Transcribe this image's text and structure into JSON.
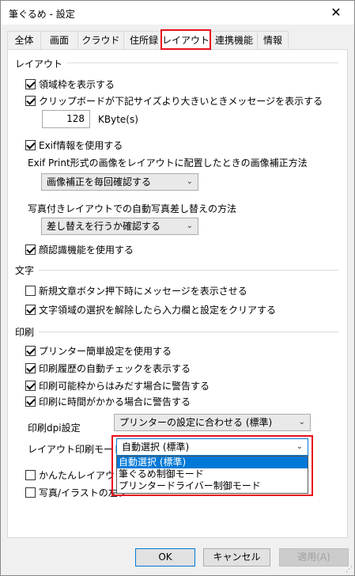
{
  "window": {
    "title": "筆ぐるめ - 設定",
    "close_label": "✕"
  },
  "tabs": [
    "全体",
    "画面",
    "クラウド",
    "住所録",
    "レイアウト",
    "連携機能",
    "情報"
  ],
  "active_tab": "レイアウト",
  "layout": {
    "section": "レイアウト",
    "show_area_frame": "領域枠を表示する",
    "clipboard_msg": "クリップボードが下記サイズより大きいときメッセージを表示する",
    "size_value": "128",
    "size_unit": "KByte(s)",
    "use_exif": "Exif情報を使用する",
    "exif_label": "Exif Print形式の画像をレイアウトに配置したときの画像補正方法",
    "exif_select": "画像補正を毎回確認する",
    "photo_label": "写真付きレイアウトでの自動写真差し替えの方法",
    "photo_select": "差し替えを行うか確認する",
    "face_recog": "顔認識機能を使用する"
  },
  "text": {
    "section": "文字",
    "new_text_msg": "新規文章ボタン押下時にメッセージを表示させる",
    "clear_input": "文字領域の選択を解除したら入力欄と設定をクリアする"
  },
  "print": {
    "section": "印刷",
    "easy_settings": "プリンター簡単設定を使用する",
    "auto_check": "印刷履歴の自動チェックを表示する",
    "warn_outside": "印刷可能枠からはみだす場合に警告する",
    "warn_time": "印刷に時間がかかる場合に警告する",
    "dpi_label": "印刷dpi設定",
    "dpi_select": "プリンターの設定に合わせる (標準)",
    "mode_label": "レイアウト印刷モード",
    "mode_select": "自動選択 (標準)",
    "mode_options": [
      "自動選択 (標準)",
      "筆ぐるめ制御モード",
      "プリンタードライバー制御モード"
    ],
    "easy_layout": "かんたんレイアウトを",
    "photo_illust": "写真/イラストの左ク"
  },
  "buttons": {
    "ok": "OK",
    "cancel": "キャンセル",
    "apply": "適用(A)"
  },
  "colors": {
    "highlight": "#e8101c",
    "selection": "#0078d7"
  },
  "states": {
    "show_area_frame": true,
    "clipboard_msg": true,
    "use_exif": true,
    "face_recog": true,
    "new_text_msg": false,
    "clear_input": true,
    "easy_settings": true,
    "auto_check": true,
    "warn_outside": true,
    "warn_time": true,
    "easy_layout": false,
    "photo_illust": false
  }
}
